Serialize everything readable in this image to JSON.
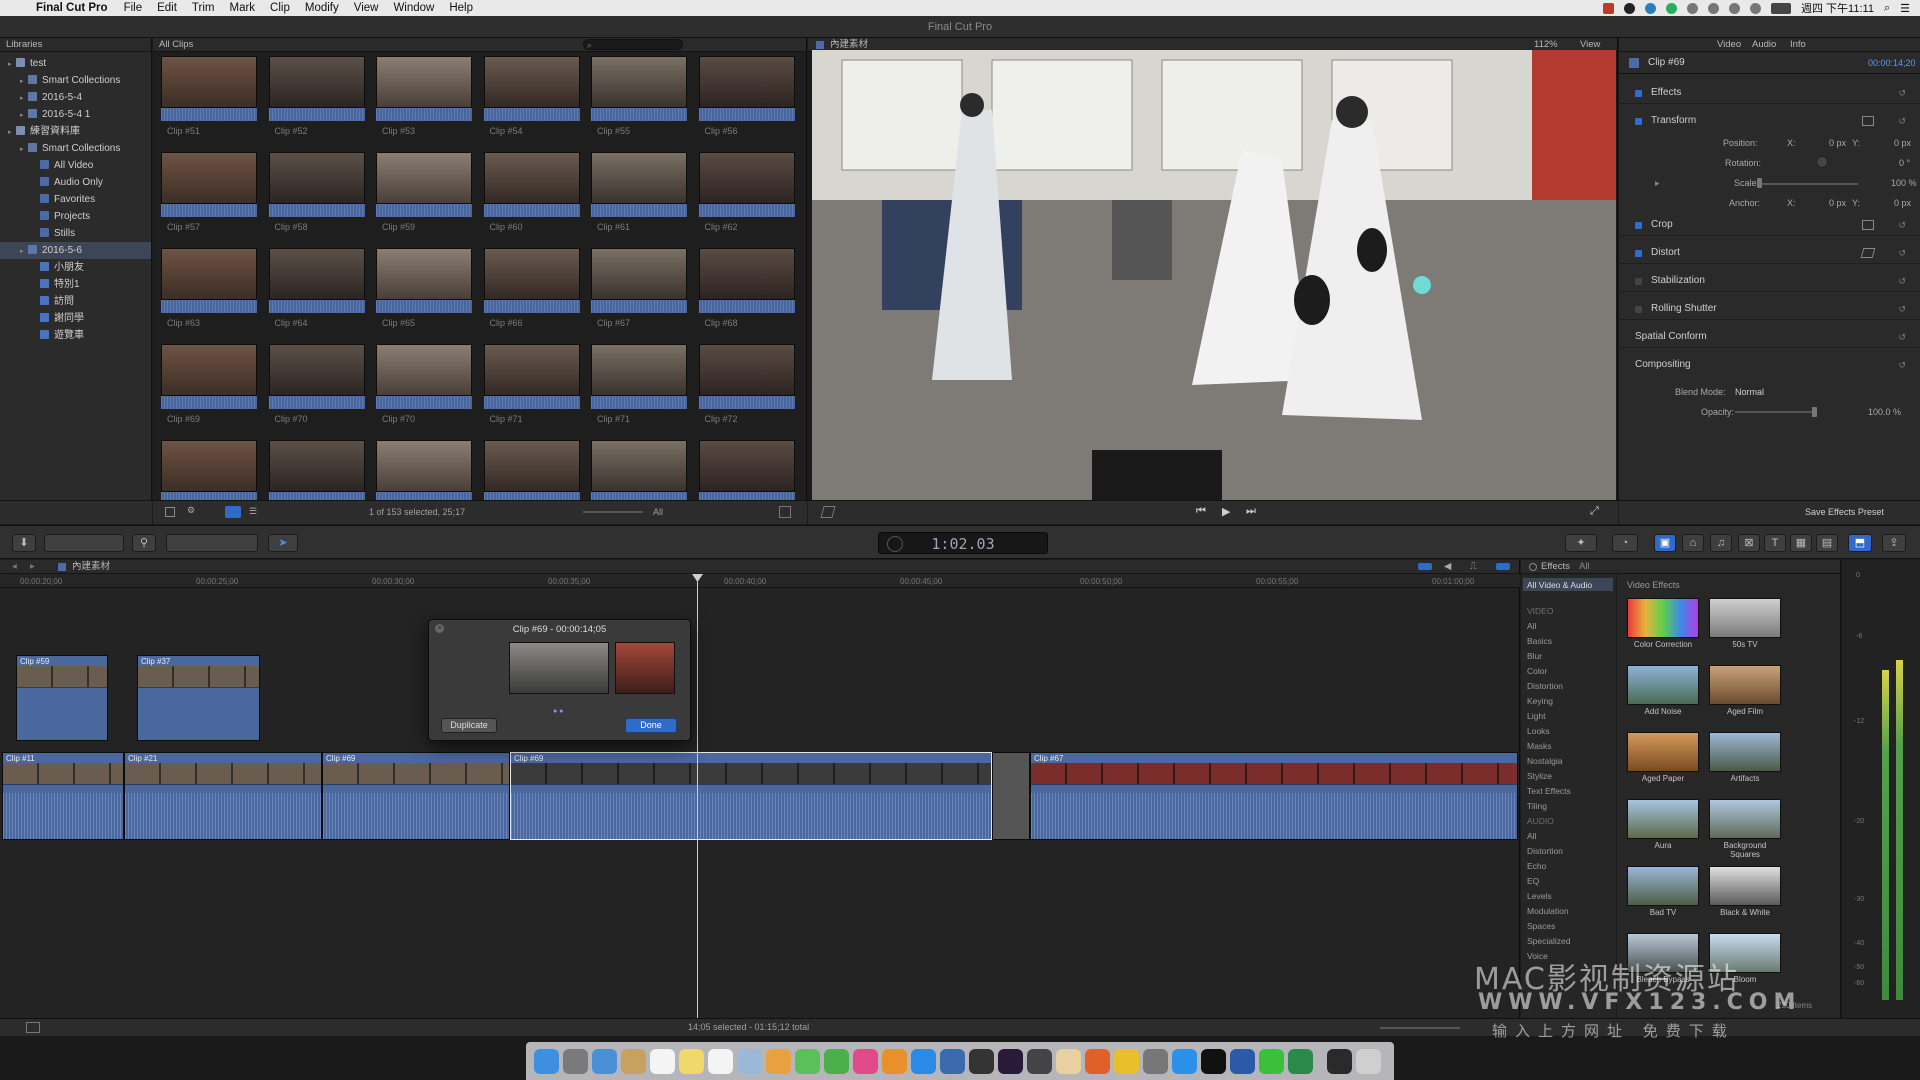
{
  "menubar": {
    "app_name": "Final Cut Pro",
    "items": [
      "File",
      "Edit",
      "Trim",
      "Mark",
      "Clip",
      "Modify",
      "View",
      "Window",
      "Help"
    ],
    "clock": "週四 下午11:11"
  },
  "window": {
    "title": "Final Cut Pro"
  },
  "libraries": {
    "header": "Libraries",
    "rows": [
      {
        "label": "test",
        "indent": 0,
        "icon": "library-icon"
      },
      {
        "label": "Smart Collections",
        "indent": 1,
        "icon": "folder-icon"
      },
      {
        "label": "2016-5-4",
        "indent": 1,
        "icon": "event-icon"
      },
      {
        "label": "2016-5-4 1",
        "indent": 1,
        "icon": "event-icon"
      },
      {
        "label": "練習資料庫",
        "indent": 0,
        "icon": "library-icon"
      },
      {
        "label": "Smart Collections",
        "indent": 1,
        "icon": "folder-icon"
      },
      {
        "label": "All Video",
        "indent": 2,
        "icon": "smart-collection-icon"
      },
      {
        "label": "Audio Only",
        "indent": 2,
        "icon": "smart-collection-icon"
      },
      {
        "label": "Favorites",
        "indent": 2,
        "icon": "smart-collection-icon"
      },
      {
        "label": "Projects",
        "indent": 2,
        "icon": "smart-collection-icon"
      },
      {
        "label": "Stills",
        "indent": 2,
        "icon": "smart-collection-icon"
      },
      {
        "label": "2016-5-6",
        "indent": 1,
        "icon": "event-icon",
        "selected": true
      },
      {
        "label": "小朋友",
        "indent": 2,
        "icon": "keyword-icon"
      },
      {
        "label": "特別1",
        "indent": 2,
        "icon": "keyword-icon"
      },
      {
        "label": "訪問",
        "indent": 2,
        "icon": "keyword-icon"
      },
      {
        "label": "謝同學",
        "indent": 2,
        "icon": "keyword-icon"
      },
      {
        "label": "遊覽車",
        "indent": 2,
        "icon": "keyword-icon"
      }
    ]
  },
  "browser": {
    "filter": "All Clips",
    "clips": [
      "Clip #51",
      "Clip #52",
      "Clip #53",
      "Clip #54",
      "Clip #55",
      "Clip #56",
      "Clip #57",
      "Clip #58",
      "Clip #59",
      "Clip #60",
      "Clip #61",
      "Clip #62",
      "Clip #63",
      "Clip #64",
      "Clip #65",
      "Clip #66",
      "Clip #67",
      "Clip #68",
      "Clip #69",
      "Clip #70",
      "Clip #70",
      "Clip #71",
      "Clip #71",
      "Clip #72",
      "",
      "",
      "",
      "",
      "",
      ""
    ],
    "footer_status": "1 of 153 selected, 25;17",
    "footer_filter": "All"
  },
  "viewer": {
    "title": "內建素材",
    "zoom": "112%",
    "view_label": "View"
  },
  "inspector": {
    "tabs": [
      "Video",
      "Audio",
      "Info"
    ],
    "clip_name": "Clip #69",
    "clip_duration": "00:00:14;20",
    "sections": {
      "effects": "Effects",
      "transform": "Transform",
      "crop": "Crop",
      "distort": "Distort",
      "stabilization": "Stabilization",
      "rolling_shutter": "Rolling Shutter",
      "spatial_conform": "Spatial Conform",
      "compositing": "Compositing"
    },
    "params": {
      "position": "Position:",
      "rotation": "Rotation:",
      "scale": "Scale:",
      "anchor": "Anchor:",
      "x": "X:",
      "y": "Y:",
      "px_zero": "0 px",
      "deg_zero": "0 °",
      "scale_value": "100 %",
      "blend_mode_label": "Blend Mode:",
      "blend_mode_value": "Normal",
      "opacity_label": "Opacity:",
      "opacity_value": "100.0 %"
    },
    "save_preset": "Save Effects Preset"
  },
  "toolbar": {
    "timecode": "1:02.03"
  },
  "timeline": {
    "project_name": "內建素材",
    "ruler": [
      "00:00:20;00",
      "00:00:25;00",
      "00:00:30;00",
      "00:00:35;00",
      "00:00:40;00",
      "00:00:45;00",
      "00:00:50;00",
      "00:00:55;00",
      "00:01:00;00"
    ],
    "connected_clips": [
      "Clip #59",
      "Clip #37"
    ],
    "primary_clips": [
      "Clip #11",
      "Clip #21",
      "Clip #69",
      "Clip #69",
      "Clip #67"
    ],
    "status": "14;05 selected - 01:15;12 total"
  },
  "popup": {
    "title": "Clip #69 - 00:00:14;05",
    "duplicate": "Duplicate",
    "done": "Done"
  },
  "effects": {
    "title": "Effects",
    "filter": "All",
    "category_selected": "All Video & Audio",
    "section_video": "VIDEO",
    "video_categories": [
      "All",
      "Basics",
      "Blur",
      "Color",
      "Distortion",
      "Keying",
      "Light",
      "Looks",
      "Masks",
      "Nostalgia",
      "Stylize",
      "Text Effects",
      "Tiling"
    ],
    "section_audio": "AUDIO",
    "audio_categories": [
      "All",
      "Distortion",
      "Echo",
      "EQ",
      "Levels",
      "Modulation",
      "Spaces",
      "Specialized",
      "Voice"
    ],
    "grid_title": "Video Effects",
    "items": [
      "Color Correction",
      "50s TV",
      "Add Noise",
      "Aged Film",
      "Aged Paper",
      "Artifacts",
      "Aura",
      "Background Squares",
      "Bad TV",
      "Black & White",
      "Bleach Bypass",
      "Bloom"
    ],
    "count": "230 Items"
  },
  "meters": {
    "scale": [
      "0",
      "-6",
      "-12",
      "-20",
      "-30",
      "-40",
      "-50",
      "-60"
    ]
  },
  "watermark": {
    "line1": "MAC影视制资源站",
    "line2": "WWW.VFX123.COM",
    "line3": "输入上方网址 免费下载"
  },
  "colors": {
    "accent": "#1f5fbf",
    "clip_blue": "#4a679e",
    "panel": "#2a2a2a"
  }
}
